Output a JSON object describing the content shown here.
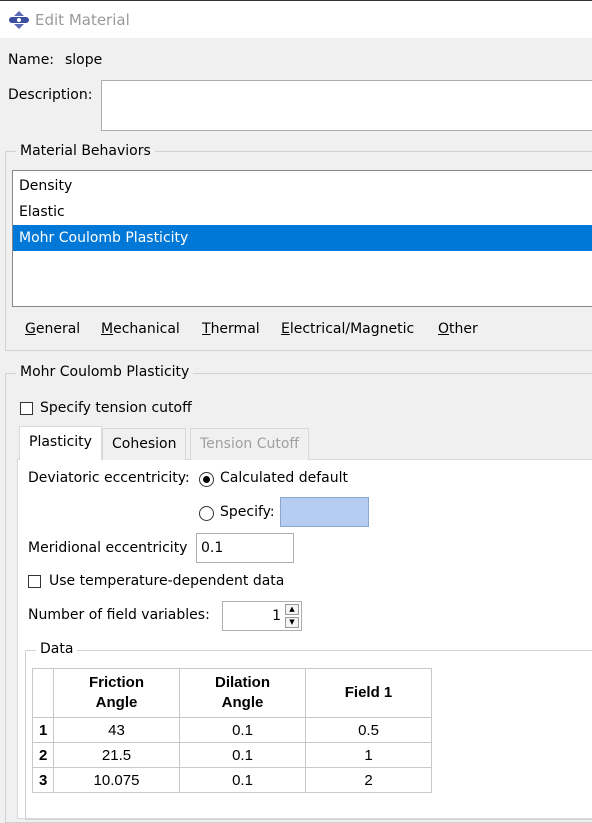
{
  "window": {
    "title": "Edit Material",
    "icon": "abaqus-app-icon"
  },
  "name": {
    "label": "Name:",
    "value": "slope"
  },
  "description": {
    "label": "Description:",
    "value": ""
  },
  "behaviors": {
    "group_title": "Material Behaviors",
    "items": [
      {
        "label": "Density",
        "selected": false
      },
      {
        "label": "Elastic",
        "selected": false
      },
      {
        "label": "Mohr Coulomb Plasticity",
        "selected": true
      }
    ],
    "menus": [
      {
        "accel": "G",
        "rest": "eneral"
      },
      {
        "accel": "M",
        "rest": "echanical"
      },
      {
        "accel": "T",
        "rest": "hermal"
      },
      {
        "accel": "E",
        "rest": "lectrical/Magnetic"
      },
      {
        "accel": "O",
        "rest": "ther"
      }
    ]
  },
  "section": {
    "title": "Mohr Coulomb Plasticity",
    "tension_cutoff": {
      "label": "Specify tension cutoff",
      "checked": false
    },
    "tabs": [
      {
        "label": "Plasticity",
        "state": "active"
      },
      {
        "label": "Cohesion",
        "state": "normal"
      },
      {
        "label": "Tension Cutoff",
        "state": "disabled"
      }
    ],
    "deviatoric": {
      "label": "Deviatoric eccentricity:",
      "option_default": "Calculated default",
      "option_specify": "Specify:",
      "selected": "default"
    },
    "meridional": {
      "label": "Meridional eccentricity",
      "value": "0.1"
    },
    "temp_dependent": {
      "label": "Use temperature-dependent data",
      "checked": false
    },
    "field_vars": {
      "label": "Number of field variables:",
      "value": "1"
    },
    "data": {
      "title": "Data",
      "columns": [
        [
          "Friction",
          "Angle"
        ],
        [
          "Dilation",
          "Angle"
        ],
        [
          "Field 1",
          ""
        ]
      ],
      "rows": [
        [
          "1",
          "43",
          "0.1",
          "0.5"
        ],
        [
          "2",
          "21.5",
          "0.1",
          "1"
        ],
        [
          "3",
          "10.075",
          "0.1",
          "2"
        ]
      ]
    }
  },
  "colors": {
    "selection": "#0078d7",
    "specify_field": "#b4cdf0",
    "background": "#f0f0f0"
  }
}
